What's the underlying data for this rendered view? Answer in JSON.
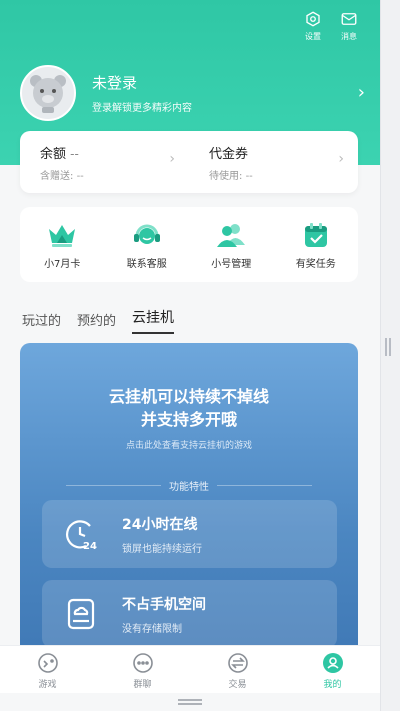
{
  "header": {
    "settings_label": "设置",
    "messages_label": "消息"
  },
  "profile": {
    "name": "未登录",
    "subtitle": "登录解锁更多精彩内容"
  },
  "balance": {
    "left": {
      "title": "余额",
      "value": "--",
      "sub_label": "含赠送:",
      "sub_value": "--"
    },
    "right": {
      "title": "代金券",
      "sub_label": "待使用:",
      "sub_value": "--"
    }
  },
  "quick_menu": [
    {
      "label": "小7月卡",
      "icon": "crown-icon"
    },
    {
      "label": "联系客服",
      "icon": "headset-icon"
    },
    {
      "label": "小号管理",
      "icon": "accounts-icon"
    },
    {
      "label": "有奖任务",
      "icon": "task-calendar-icon"
    }
  ],
  "tabs": [
    {
      "label": "玩过的",
      "active": false
    },
    {
      "label": "预约的",
      "active": false
    },
    {
      "label": "云挂机",
      "active": true
    }
  ],
  "cloud": {
    "title_line1": "云挂机可以持续不掉线",
    "title_line2": "并支持多开哦",
    "subtitle": "点击此处查看支持云挂机的游戏",
    "features_heading": "功能特性",
    "features": [
      {
        "title": "24小时在线",
        "desc": "锁屏也能持续运行",
        "icon": "clock-24-icon"
      },
      {
        "title": "不占手机空间",
        "desc": "没有存储限制",
        "icon": "cloud-storage-icon"
      }
    ]
  },
  "bottom_nav": [
    {
      "label": "游戏",
      "icon": "game-icon",
      "active": false
    },
    {
      "label": "群聊",
      "icon": "chat-icon",
      "active": false
    },
    {
      "label": "交易",
      "icon": "trade-icon",
      "active": false
    },
    {
      "label": "我的",
      "icon": "profile-icon",
      "active": true
    }
  ],
  "colors": {
    "accent": "#2ec6a3",
    "cloud_panel": "#4b86c1"
  }
}
